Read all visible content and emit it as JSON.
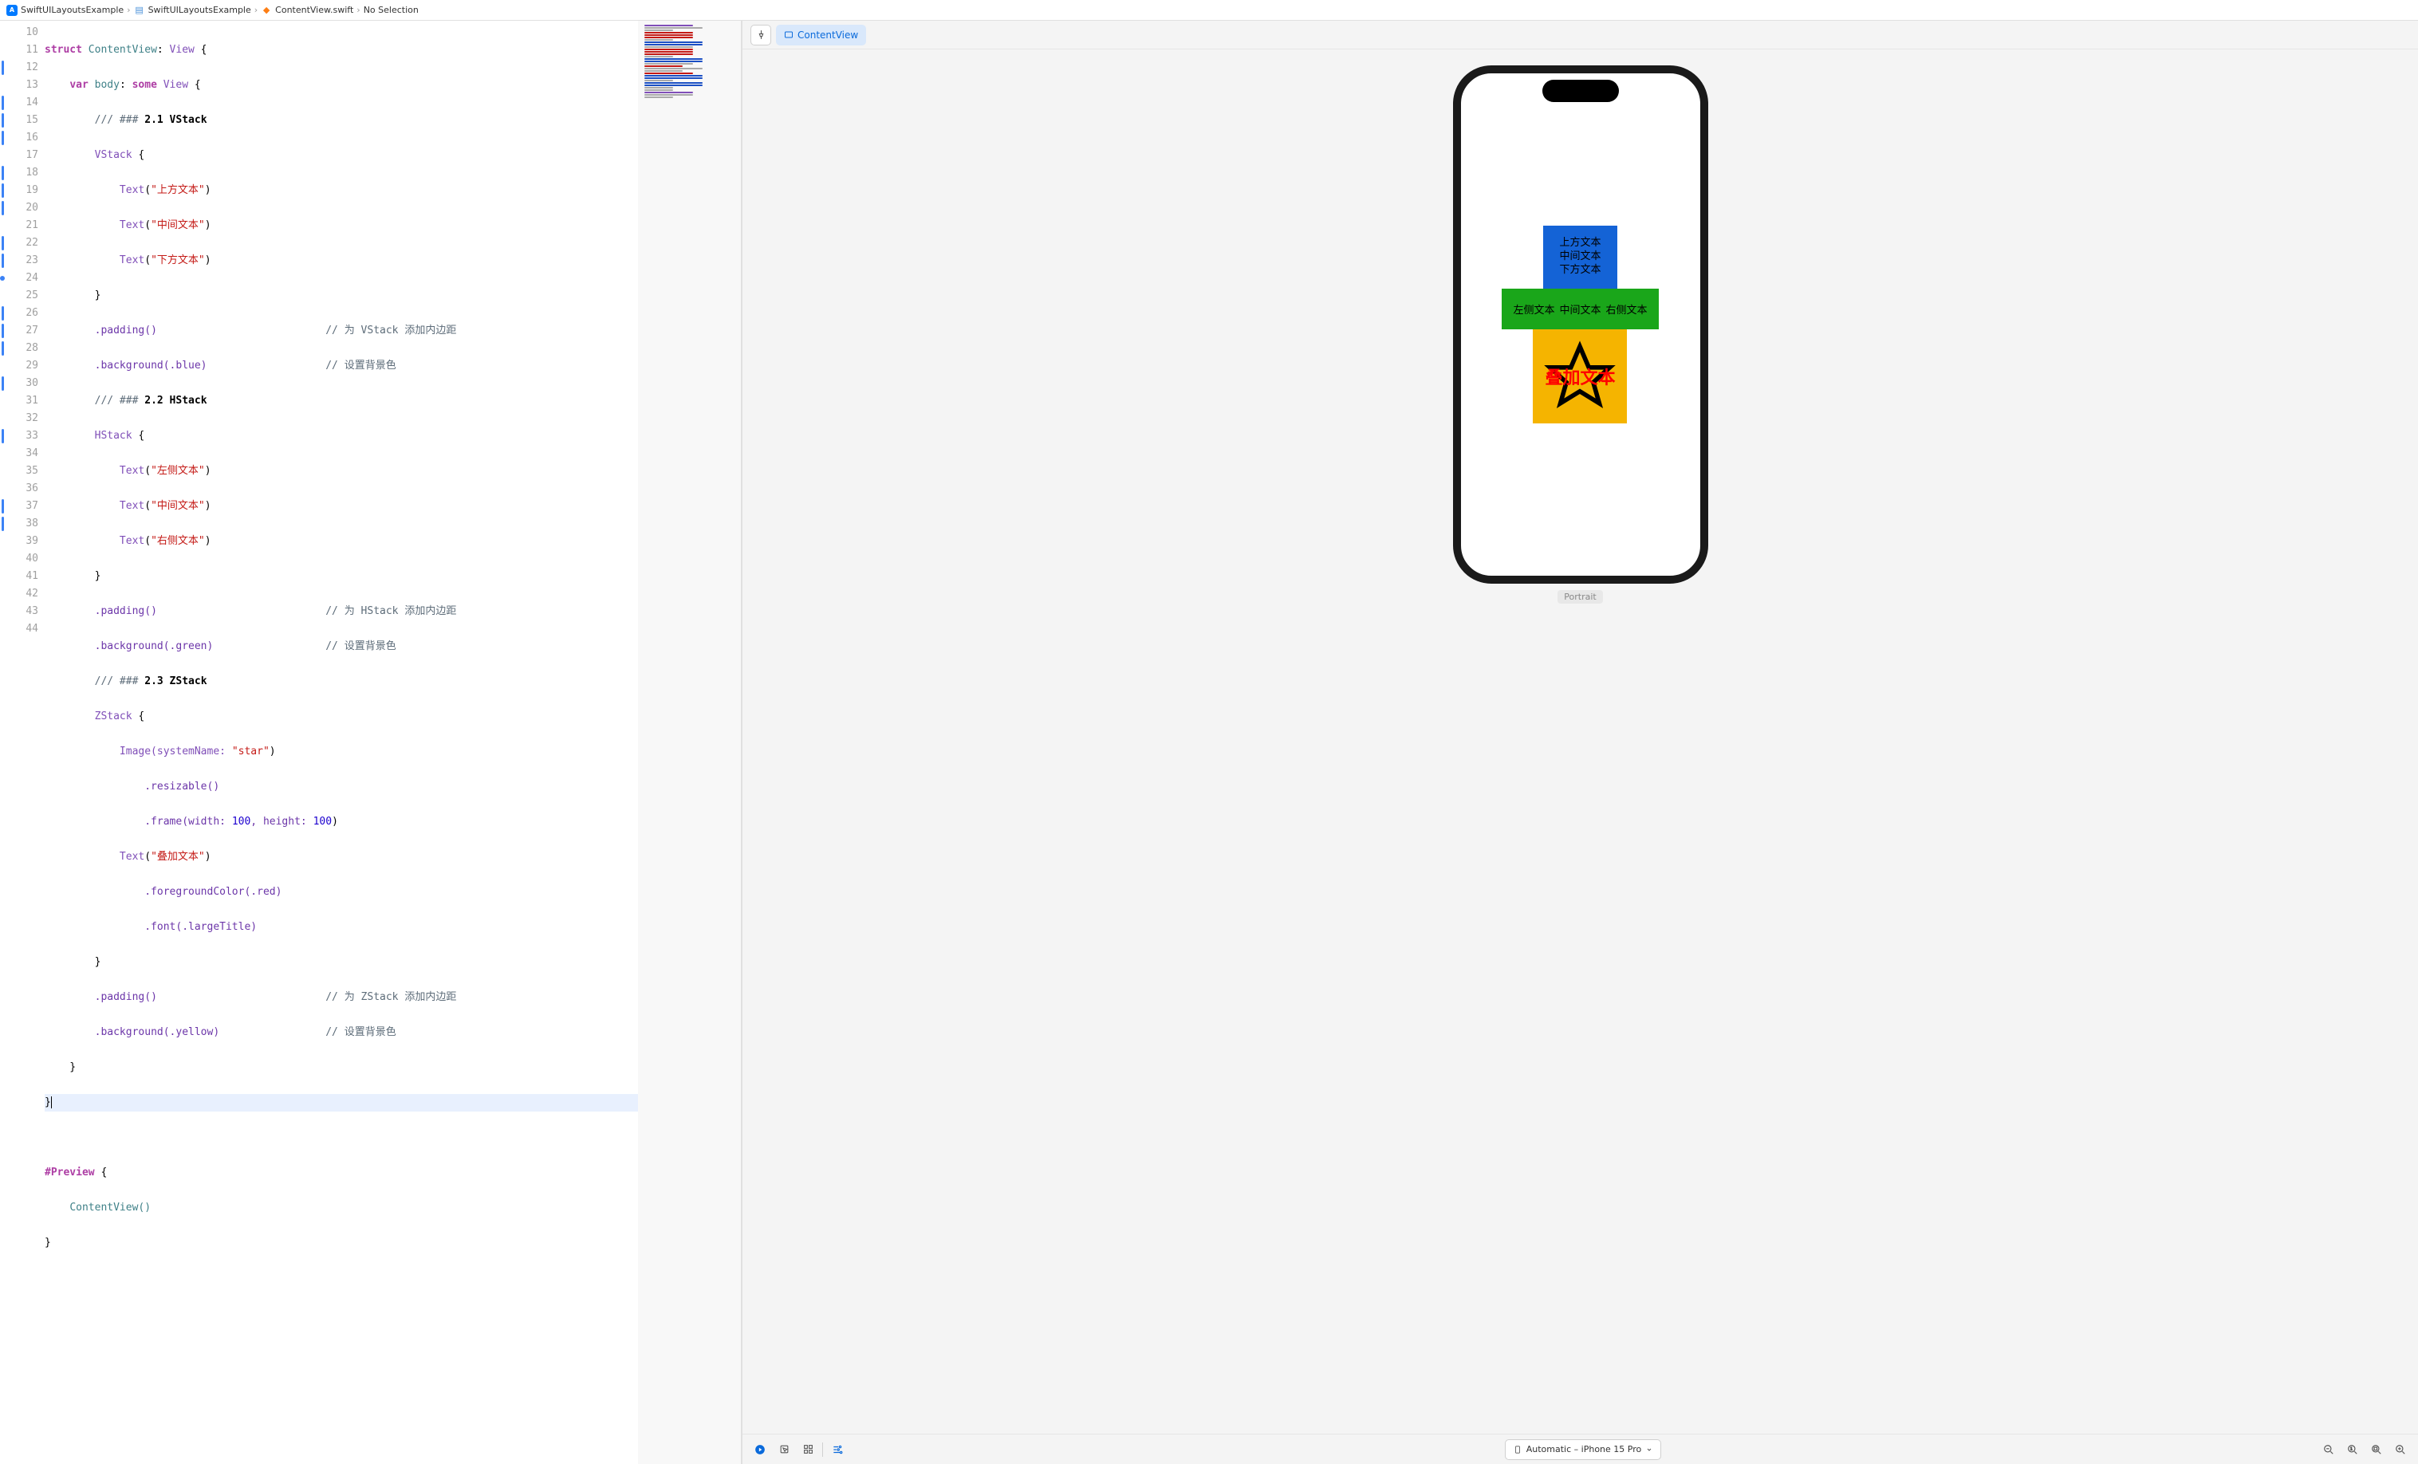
{
  "breadcrumb": {
    "project": "SwiftUILayoutsExample",
    "group": "SwiftUILayoutsExample",
    "file": "ContentView.swift",
    "selection": "No Selection"
  },
  "line_numbers": [
    10,
    11,
    12,
    13,
    14,
    15,
    16,
    17,
    18,
    19,
    20,
    21,
    22,
    23,
    24,
    25,
    26,
    27,
    28,
    29,
    30,
    31,
    32,
    33,
    34,
    35,
    36,
    37,
    38,
    39,
    40,
    41,
    42,
    43,
    44
  ],
  "code": {
    "struct_kw": "struct",
    "struct_name": "ContentView",
    "view_proto": "View",
    "var_kw": "var",
    "body_name": "body",
    "some_kw": "some",
    "c12": "/// ### ",
    "c12b": "2.1 VStack",
    "vstack": "VStack",
    "t_top": "\"上方文本\"",
    "t_mid": "\"中间文本\"",
    "t_bot": "\"下方文本\"",
    "padding": ".padding()",
    "bg_blue": ".background(.blue)",
    "cmt_vpad": "// 为 VStack 添加内边距",
    "cmt_bg": "// 设置背景色",
    "c20": "/// ### ",
    "c20b": "2.2 HStack",
    "hstack": "HStack",
    "t_left": "\"左侧文本\"",
    "t_mid2": "\"中间文本\"",
    "t_right": "\"右侧文本\"",
    "bg_green": ".background(.green)",
    "cmt_hpad": "// 为 HStack 添加内边距",
    "c28": "/// ### ",
    "c28b": "2.3 ZStack",
    "zstack": "ZStack",
    "image_call": "Image(systemName: ",
    "star": "\"star\"",
    "resizable": ".resizable()",
    "frame": ".frame(width: ",
    "n100a": "100",
    "frame_mid": ", height: ",
    "n100b": "100",
    "t_overlay": "\"叠加文本\"",
    "fg_red": ".foregroundColor(.red)",
    "font_lt": ".font(.largeTitle)",
    "bg_yellow": ".background(.yellow)",
    "cmt_zpad": "// 为 ZStack 添加内边距",
    "preview_macro": "#Preview",
    "cv_call": "ContentView()",
    "text_fn": "Text"
  },
  "preview": {
    "chip": "ContentView",
    "vstack": {
      "line1": "上方文本",
      "line2": "中间文本",
      "line3": "下方文本"
    },
    "hstack": {
      "c1": "左侧文本",
      "c2": "中间文本",
      "c3": "右侧文本"
    },
    "zstack": {
      "overlay": "叠加文本"
    },
    "orientation": "Portrait"
  },
  "footer": {
    "device": "Automatic – iPhone 15 Pro"
  }
}
